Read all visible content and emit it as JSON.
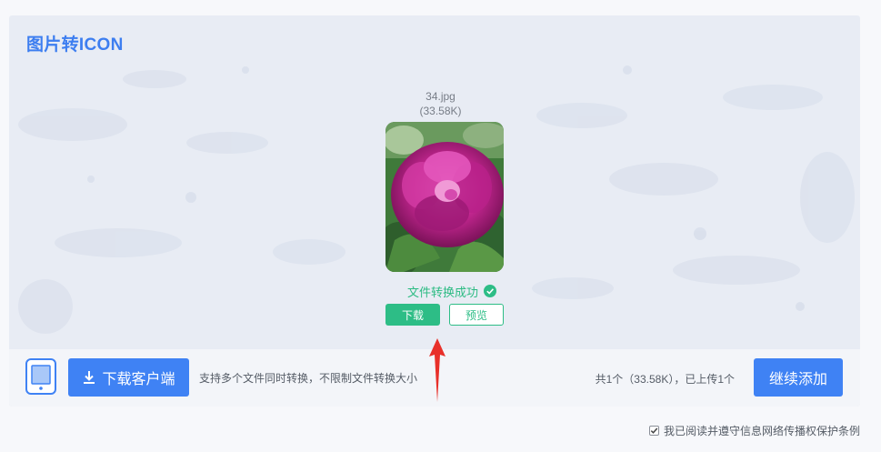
{
  "header": {
    "title": "图片转ICON"
  },
  "file": {
    "name": "34.jpg",
    "size": "(33.58K)",
    "status": "文件转换成功",
    "download_label": "下载",
    "preview_label": "预览"
  },
  "toolbar": {
    "client_button_label": "下载客户端",
    "tip": "支持多个文件同时转换，不限制文件转换大小",
    "summary": "共1个（33.58K），已上传1个",
    "continue_label": "继续添加"
  },
  "footer": {
    "agreement": "我已阅读并遵守信息网络传播权保护条例",
    "agreement_checked": true
  },
  "colors": {
    "title": "#3d7ef0",
    "success": "#2dbd86",
    "primary_button": "#3f82f4",
    "panel_bg": "#e8ecf4",
    "annotation_arrow": "#e8302a"
  },
  "icons": [
    "success-check-icon",
    "tablet-device-icon",
    "download-icon",
    "checkbox-checked-icon",
    "red-arrow-annotation"
  ]
}
